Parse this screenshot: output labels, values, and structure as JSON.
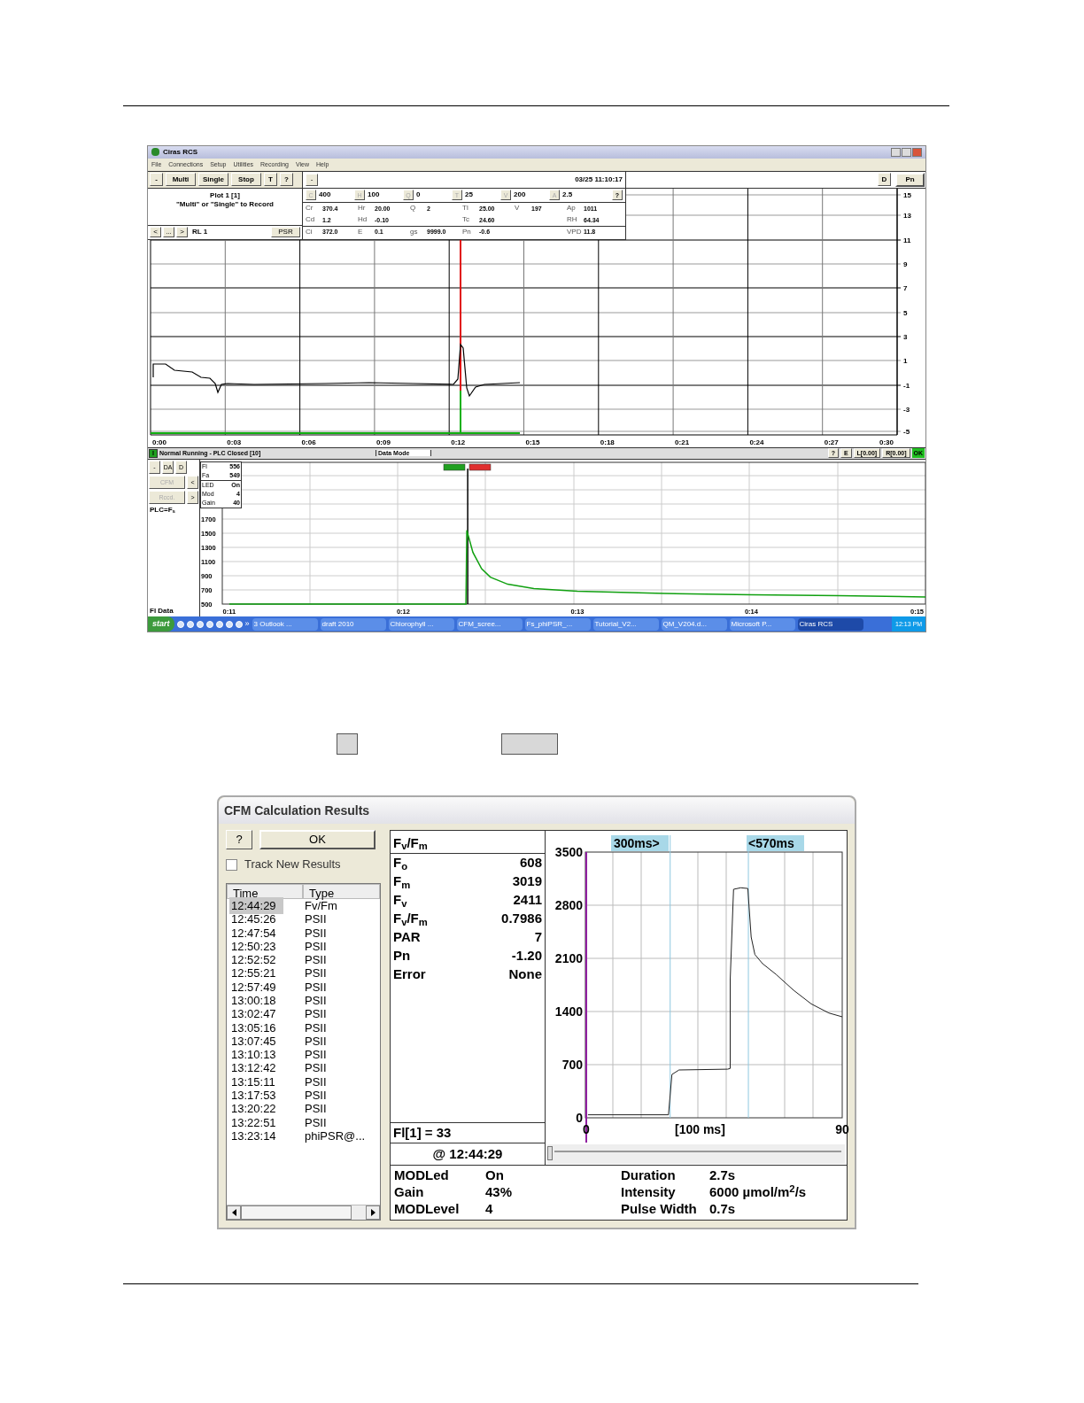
{
  "main_window": {
    "title": "Ciras RCS",
    "menu": [
      "File",
      "Connections",
      "Setup",
      "Utilities",
      "Recording",
      "View",
      "Help"
    ],
    "toolbar": [
      "-",
      "Multi",
      "Single",
      "Stop",
      "T",
      "?"
    ],
    "plot_info": [
      "Plot 1 [1]",
      "\"Multi\" or \"Single\" to Record"
    ],
    "nav_buttons": [
      "<",
      "...",
      ">"
    ],
    "record_label": "RL 1",
    "psr_button": "PSR",
    "data_panel": {
      "collapse_button": "-",
      "datetime": "03/25 11:10:17",
      "setpoints": [
        {
          "key": "C",
          "value": "400"
        },
        {
          "key": "H",
          "value": "100"
        },
        {
          "key": "Q",
          "value": "0"
        },
        {
          "key": "T",
          "value": "25"
        },
        {
          "key": "V",
          "value": "200"
        },
        {
          "key": "A",
          "value": "2.5"
        }
      ],
      "help_button": "?",
      "readings": [
        [
          {
            "label": "Cr",
            "value": "370.4"
          },
          {
            "label": "Hr",
            "value": "20.00"
          },
          {
            "label": "Q",
            "value": "2"
          },
          {
            "label": "Tl",
            "value": "25.00"
          },
          {
            "label": "V",
            "value": "197"
          },
          {
            "label": "Ap",
            "value": "1011"
          }
        ],
        [
          {
            "label": "Cd",
            "value": "1.2"
          },
          {
            "label": "Hd",
            "value": "-0.10"
          },
          {
            "label": "Tc",
            "value": "24.60"
          },
          {
            "label": "RH",
            "value": "64.34"
          }
        ],
        [
          {
            "label": "Ci",
            "value": "372.0"
          },
          {
            "label": "E",
            "value": "0.1"
          },
          {
            "label": "gs",
            "value": "9999.0"
          },
          {
            "label": "Pn",
            "value": "-0.6"
          },
          {
            "label": "VPD",
            "value": "11.8"
          }
        ]
      ]
    },
    "right_buttons": [
      "D",
      "Pn"
    ],
    "chart": {
      "yticks": [
        "15",
        "13",
        "11",
        "9",
        "7",
        "5",
        "3",
        "1",
        "-1",
        "-3",
        "-5"
      ],
      "xticks": [
        "0:00",
        "0:03",
        "0:06",
        "0:09",
        "0:12",
        "0:15",
        "0:18",
        "0:21",
        "0:24",
        "0:27",
        "0:30"
      ]
    },
    "status_bar": {
      "indicator": "I",
      "status": "Normal Running - PLC Closed [10]",
      "mode": "Data Mode",
      "buttons": [
        "?",
        "E",
        "L[0.00]",
        "R[0.00]"
      ],
      "ok": "OK"
    },
    "lower_panel": {
      "button_rows": [
        [
          {
            "label": "-",
            "disabled": false
          },
          {
            "label": "DA",
            "disabled": false
          },
          {
            "label": "D",
            "disabled": false
          }
        ],
        [
          {
            "label": "CFM",
            "disabled": true
          },
          {
            "label": "<",
            "disabled": false
          }
        ],
        [
          {
            "label": "Rccd.",
            "disabled": true
          },
          {
            "label": ">",
            "disabled": false
          }
        ]
      ],
      "plc_label": "PLC=F$_{s}$",
      "data_label": "Fl Data",
      "readout": [
        [
          {
            "label": "Fl",
            "value": "556"
          },
          {
            "label": "Fa",
            "value": "549"
          }
        ],
        [
          {
            "label": "LED",
            "value": "On"
          },
          {
            "label": "Mod",
            "value": "4"
          },
          {
            "label": "Gain",
            "value": "40"
          }
        ]
      ],
      "chart_data": {
        "type": "line",
        "grid": true,
        "xlim": [
          10.96,
          15.0
        ],
        "ylim": [
          500,
          2500
        ],
        "ref_lines": [
          {
            "axis": "x",
            "value": 12.37,
            "color": "#000000"
          }
        ],
        "xticks": [
          {
            "value": 11,
            "label": "0:11"
          },
          {
            "value": 12,
            "label": "0:12"
          },
          {
            "value": 13,
            "label": "0:13"
          },
          {
            "value": 14,
            "label": "0:14"
          },
          {
            "value": 15,
            "label": "0:15"
          }
        ],
        "yticks": [
          1700,
          1500,
          1300,
          1100,
          900,
          700,
          500
        ],
        "x": [
          11,
          12.36,
          12.365,
          12.4,
          12.45,
          12.5,
          12.6,
          12.75,
          13.0,
          13.5,
          14.0,
          14.5,
          15.0
        ],
        "series": [
          {
            "color": "#10a010",
            "values": [
              500,
              500,
              1540,
              1230,
              1000,
              880,
              780,
              720,
              680,
              650,
              630,
              620,
              600
            ]
          }
        ]
      }
    },
    "taskbar": {
      "start": "start",
      "more": "»",
      "tasks": [
        {
          "label": "3 Outlook ...",
          "selected": false
        },
        {
          "label": "draft 2010",
          "selected": false
        },
        {
          "label": "Chlorophyll ...",
          "selected": false
        },
        {
          "label": "CFM_scree...",
          "selected": false
        },
        {
          "label": "Fs_phiPSR_...",
          "selected": false
        },
        {
          "label": "Tutorial_V2...",
          "selected": false
        },
        {
          "label": "QM_V204.d...",
          "selected": false
        },
        {
          "label": "Microsoft P...",
          "selected": false
        },
        {
          "label": "Ciras RCS",
          "selected": true
        }
      ],
      "clock": "12:13 PM"
    }
  },
  "cfm_dialog": {
    "title": "CFM Calculation Results",
    "help_button": "?",
    "ok_button": "OK",
    "track_new_results": {
      "label": "Track New Results",
      "checked": false
    },
    "columns": [
      "Time",
      "Type"
    ],
    "rows": [
      {
        "time": "12:44:29",
        "type": "Fv/Fm",
        "selected": true
      },
      {
        "time": "12:45:26",
        "type": "PSII",
        "selected": false
      },
      {
        "time": "12:47:54",
        "type": "PSII",
        "selected": false
      },
      {
        "time": "12:50:23",
        "type": "PSII",
        "selected": false
      },
      {
        "time": "12:52:52",
        "type": "PSII",
        "selected": false
      },
      {
        "time": "12:55:21",
        "type": "PSII",
        "selected": false
      },
      {
        "time": "12:57:49",
        "type": "PSII",
        "selected": false
      },
      {
        "time": "13:00:18",
        "type": "PSII",
        "selected": false
      },
      {
        "time": "13:02:47",
        "type": "PSII",
        "selected": false
      },
      {
        "time": "13:05:16",
        "type": "PSII",
        "selected": false
      },
      {
        "time": "13:07:45",
        "type": "PSII",
        "selected": false
      },
      {
        "time": "13:10:13",
        "type": "PSII",
        "selected": false
      },
      {
        "time": "13:12:42",
        "type": "PSII",
        "selected": false
      },
      {
        "time": "13:15:11",
        "type": "PSII",
        "selected": false
      },
      {
        "time": "13:17:53",
        "type": "PSII",
        "selected": false
      },
      {
        "time": "13:20:22",
        "type": "PSII",
        "selected": false
      },
      {
        "time": "13:22:51",
        "type": "PSII",
        "selected": false
      },
      {
        "time": "13:23:14",
        "type": "phiPSR@...",
        "selected": false
      }
    ],
    "result_heading": "F$_{v}$/F$_{m}$",
    "results": [
      {
        "label": "F$_{o}$",
        "value": "608"
      },
      {
        "label": "F$_{m}$",
        "value": "3019"
      },
      {
        "label": "F$_{v}$",
        "value": "2411"
      },
      {
        "label": "F$_{v}$/F$_{m}$",
        "value": "0.7986"
      },
      {
        "label": "PAR",
        "value": "7"
      },
      {
        "label": "Pn",
        "value": "-1.20"
      },
      {
        "label": "Error",
        "value": "None"
      }
    ],
    "fl_value": "Fl[1] = 33",
    "timestamp": "@ 12:44:29",
    "chart_data": {
      "type": "line",
      "grid": true,
      "xlabel": "[100 ms]",
      "xlim": [
        0,
        90
      ],
      "ylim": [
        0,
        3500
      ],
      "xticks": [
        0,
        90
      ],
      "yticks": [
        3500,
        2800,
        2100,
        1400,
        700,
        0
      ],
      "annotations": [
        "300ms>",
        "<570ms"
      ],
      "ref_lines": [
        {
          "axis": "x",
          "value": 29.5,
          "color": "#8fc8e0"
        },
        {
          "axis": "x",
          "value": 57,
          "color": "#8fc8e0"
        }
      ],
      "x": [
        0.6,
        28.9,
        30.1,
        32.6,
        49.7,
        50.6,
        50.6,
        51.8,
        54.3,
        56.8,
        58,
        59.3,
        62,
        66.7,
        72.9,
        79.1,
        85.3,
        90
      ],
      "series": [
        {
          "color": "#222222",
          "values": [
            40,
            40,
            570,
            630,
            640,
            650,
            1820,
            3010,
            3030,
            3020,
            2380,
            2150,
            2030,
            1890,
            1680,
            1500,
            1380,
            1330
          ]
        }
      ]
    },
    "slider": {
      "level": 0
    },
    "settings": [
      [
        {
          "label": "MODLed",
          "value": "On"
        },
        {
          "label": "Gain",
          "value": "43%"
        },
        {
          "label": "MODLevel",
          "value": "4"
        }
      ],
      [
        {
          "label": "Duration",
          "value": "2.7s"
        },
        {
          "label": "Intensity",
          "value": "6000 µmol/m$^{2}$/s"
        },
        {
          "label": "Pulse Width",
          "value": "0.7s"
        }
      ]
    ]
  }
}
